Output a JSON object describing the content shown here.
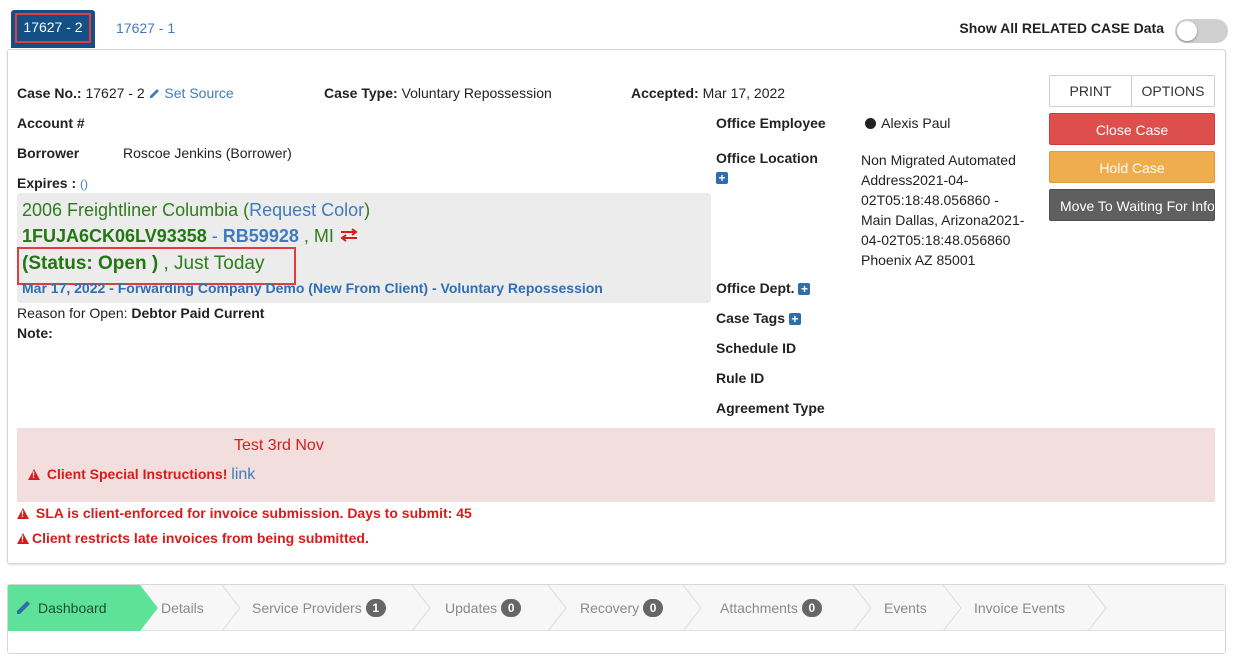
{
  "tabs": [
    {
      "label": "17627 - 2",
      "active": true
    },
    {
      "label": "17627 - 1",
      "active": false
    }
  ],
  "related_toggle": {
    "label": "Show All RELATED CASE Data",
    "on": false
  },
  "case": {
    "case_no_label": "Case No.:",
    "case_no": "17627 - 2",
    "set_source": "Set Source",
    "case_type_label": "Case Type:",
    "case_type": "Voluntary Repossession",
    "accepted_label": "Accepted:",
    "accepted": "Mar 17, 2022",
    "account_label": "Account #",
    "borrower_label": "Borrower",
    "borrower": "Roscoe Jenkins (Borrower)",
    "expires_label": "Expires :",
    "expires_value": "()"
  },
  "vehicle": {
    "title": "2006 Freightliner Columbia (",
    "request_color": "Request Color",
    "title_close": ")",
    "vin": "1FUJA6CK06LV93358",
    "dash": "-",
    "plate": "RB59928",
    "state": ", MI",
    "status": "(Status: Open )",
    "status_time": ", Just Today",
    "history_link": "Mar 17, 2022 - Forwarding Company Demo (New From Client) - Voluntary Repossession"
  },
  "reason": {
    "label": "Reason for Open:",
    "value": "Debtor Paid Current"
  },
  "note_label": "Note:",
  "office": {
    "employee_label": "Office Employee",
    "employee": "Alexis Paul",
    "location_label": "Office Location",
    "location_lines": [
      "Non Migrated Automated",
      "Address2021-04-",
      "02T05:18:48.056860 -",
      "Main Dallas, Arizona2021-",
      "04-02T05:18:48.056860",
      "Phoenix AZ 85001"
    ],
    "dept_label": "Office Dept.",
    "case_tags_label": "Case Tags",
    "schedule_label": "Schedule ID",
    "rule_label": "Rule ID",
    "agreement_label": "Agreement Type"
  },
  "buttons": {
    "print": "PRINT",
    "options": "OPTIONS",
    "close_case": "Close Case",
    "hold_case": "Hold Case",
    "move_waiting": "Move To Waiting For Info"
  },
  "instructions": {
    "text": "Test 3rd Nov",
    "special_label": "Client Special Instructions!",
    "link": "link"
  },
  "alerts": [
    "SLA is client-enforced for invoice submission. Days to submit: 45",
    "Client restricts late invoices from being submitted."
  ],
  "wizard": [
    {
      "label": "Dashboard",
      "badge": null,
      "active": true
    },
    {
      "label": "Details",
      "badge": null
    },
    {
      "label": "Service Providers",
      "badge": "1"
    },
    {
      "label": "Updates",
      "badge": "0"
    },
    {
      "label": "Recovery",
      "badge": "0"
    },
    {
      "label": "Attachments",
      "badge": "0"
    },
    {
      "label": "Events",
      "badge": null
    },
    {
      "label": "Invoice Events",
      "badge": null
    }
  ],
  "colors": {
    "active_tab": "#144f86",
    "link": "#3f7bbf",
    "danger": "#d61d1d",
    "success": "#2e7d1b",
    "wizard_active": "#5ee29a"
  }
}
